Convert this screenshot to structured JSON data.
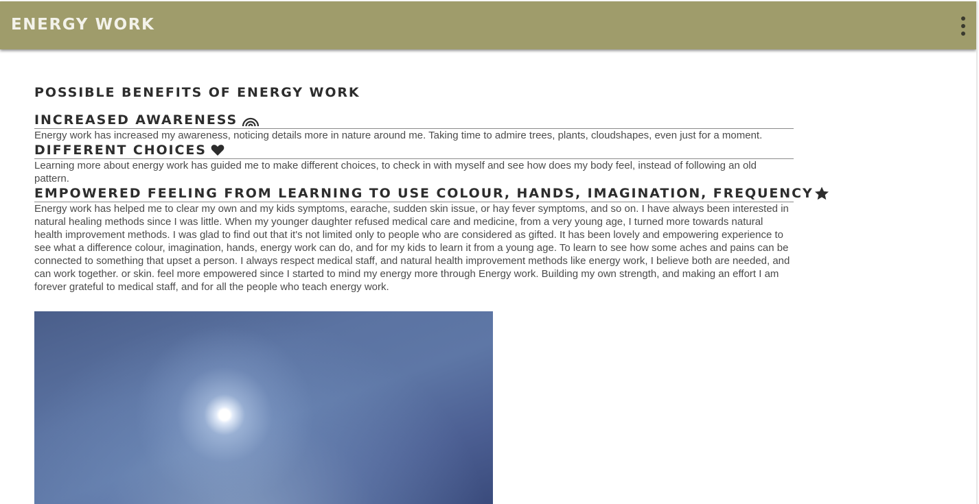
{
  "app_bar": {
    "title": "ENERGY WORK",
    "background_color": "#9f9c6b",
    "menu_icon": "more-vert-icon"
  },
  "main": {
    "heading": "POSSIBLE BENEFITS OF ENERGY WORK",
    "sections": [
      {
        "heading": "INCREASED AWARENESS",
        "icon": "rainbow-icon",
        "text": "Energy work has increased my awareness, noticing details more in nature around me. Taking time to admire trees, plants, cloudshapes, even just for a moment."
      },
      {
        "heading": "DIFFERENT CHOICES",
        "icon": "heart-icon",
        "text": "Learning more about energy work has guided me to make different choices, to check in with myself and see how does my body feel, instead of following an old pattern."
      },
      {
        "heading": "EMPOWERED FEELING FROM LEARNING TO USE COLOUR, HANDS, IMAGINATION, FREQUENCY",
        "icon": "star-icon",
        "text": "Energy work has helped me to clear my own and my kids symptoms, earache, sudden skin issue, or hay fever symptoms, and so on. I have always been interested in natural healing methods since I was little. When my younger daughter refused medical care and medicine, from a very young age, I turned more towards natural health improvement methods. I was glad to find out that it's not limited only to people who are considered as gifted. It has been lovely and empowering experience to see what a difference colour, imagination, hands, energy work can do, and for my kids to learn it from a young age. To learn to see how some aches and pains can be connected to something that upset a person. I always respect medical staff, and natural health improvement methods like energy work, I believe both are needed, and can work together. or skin. feel more empowered since I started to mind my energy more through Energy work. Building my own strength, and making an effort I am forever grateful to medical staff, and for all the people who teach energy work."
      }
    ]
  }
}
